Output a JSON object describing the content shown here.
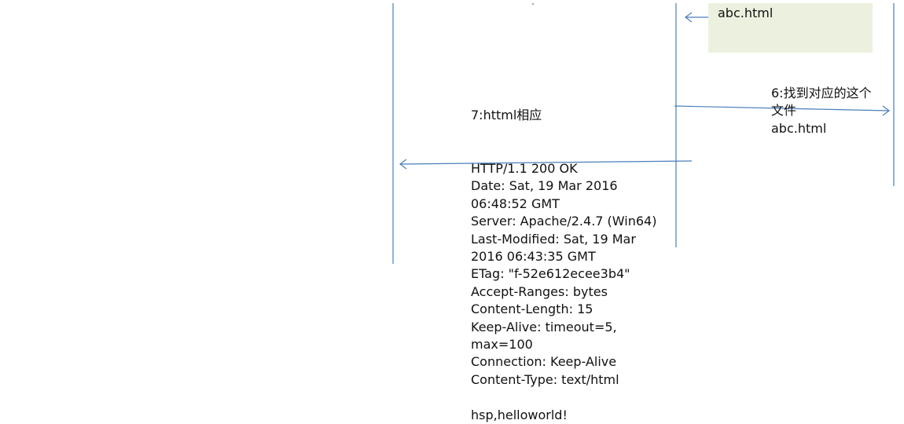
{
  "colors": {
    "line": "#4a7ebb",
    "box_fill": "#ebf1de",
    "text": "#111111"
  },
  "file_box": {
    "label": "abc.html"
  },
  "step6": {
    "lines": [
      "6:找到对应的这个",
      "文件",
      "abc.html"
    ]
  },
  "step7": {
    "label": "7:httml相应"
  },
  "response": {
    "lines": [
      "HTTP/1.1 200 OK",
      "Date: Sat, 19 Mar 2016",
      "06:48:52 GMT",
      "Server: Apache/2.4.7 (Win64)",
      "Last-Modified: Sat, 19 Mar",
      "2016 06:43:35 GMT",
      "ETag: \"f-52e612ecee3b4\"",
      "Accept-Ranges: bytes",
      "Content-Length: 15",
      "Keep-Alive: timeout=5,",
      "max=100",
      "Connection: Keep-Alive",
      "Content-Type: text/html",
      "",
      "hsp,helloworld!"
    ]
  }
}
